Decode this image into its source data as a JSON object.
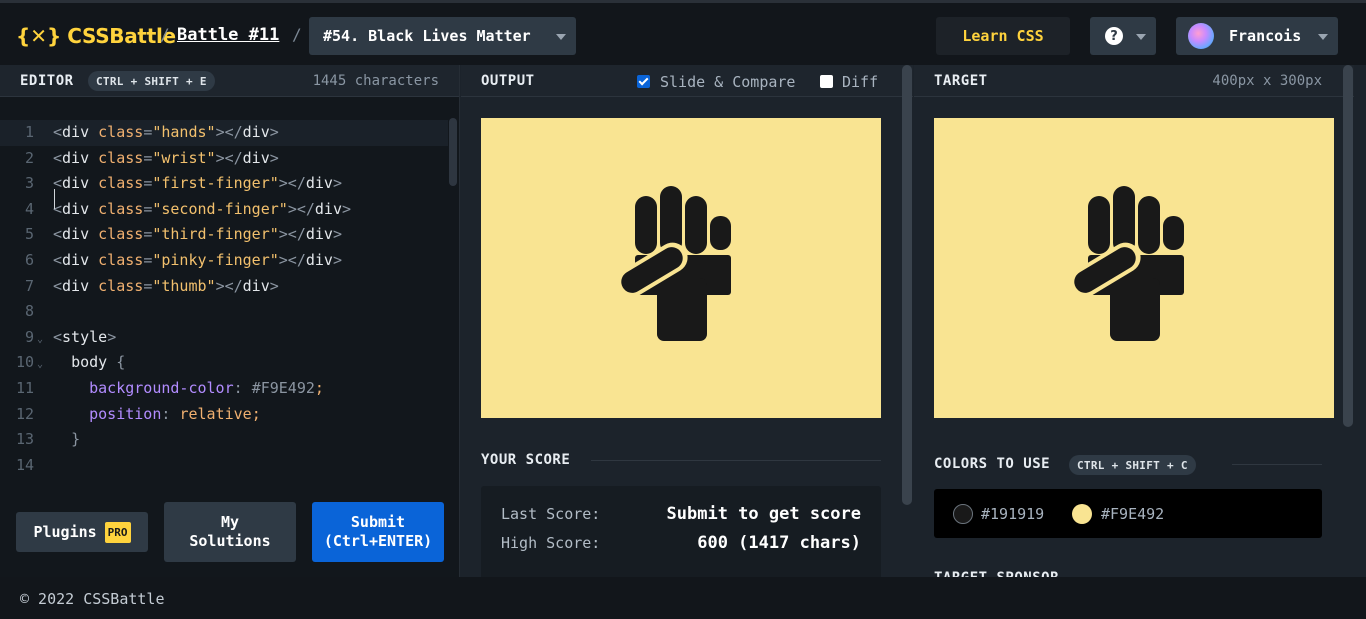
{
  "header": {
    "logo_mark": "{✕}",
    "logo_text": "CSSBattle",
    "separator": "/",
    "battle_link": "Battle #11",
    "target_name": "#54. Black Lives Matter",
    "learn_css": "Learn CSS",
    "help_glyph": "?",
    "user_name": "Francois"
  },
  "editor": {
    "title": "EDITOR",
    "shortcut": "CTRL + SHIFT + E",
    "char_count": "1445 characters",
    "lines": [
      {
        "n": "1",
        "html": "<div class=\"hands\"></div>"
      },
      {
        "n": "2",
        "html": "<div class=\"wrist\"></div>"
      },
      {
        "n": "3",
        "html": "<div class=\"first-finger\"></div>"
      },
      {
        "n": "4",
        "html": "<div class=\"second-finger\"></div>"
      },
      {
        "n": "5",
        "html": "<div class=\"third-finger\"></div>"
      },
      {
        "n": "6",
        "html": "<div class=\"pinky-finger\"></div>"
      },
      {
        "n": "7",
        "html": "<div class=\"thumb\"></div>"
      },
      {
        "n": "8",
        "html": ""
      },
      {
        "n": "9",
        "html": "<style>"
      },
      {
        "n": "10",
        "html": "  body {"
      },
      {
        "n": "11",
        "html": "    background-color: #F9E492;"
      },
      {
        "n": "12",
        "html": "    position: relative;"
      },
      {
        "n": "13",
        "html": "  }"
      },
      {
        "n": "14",
        "html": ""
      }
    ],
    "plugins_label": "Plugins",
    "pro_label": "PRO",
    "solutions_line1": "My",
    "solutions_line2": "Solutions",
    "submit_line1": "Submit",
    "submit_line2": "(Ctrl+ENTER)"
  },
  "output": {
    "title": "OUTPUT",
    "slide_compare": "Slide & Compare",
    "slide_checked": true,
    "diff": "Diff",
    "diff_checked": false,
    "score_title": "YOUR SCORE",
    "last_score_label": "Last Score:",
    "last_score_value": "Submit to get score",
    "high_score_label": "High Score:",
    "high_score_value": "600 (1417 chars)"
  },
  "target": {
    "title": "TARGET",
    "size": "400px x 300px",
    "colors_title": "COLORS TO USE",
    "colors_shortcut": "CTRL + SHIFT + C",
    "colors": [
      {
        "hex": "#191919",
        "label": "#191919"
      },
      {
        "hex": "#F9E492",
        "label": "#F9E492"
      }
    ],
    "sponsor_title": "TARGET SPONSOR"
  },
  "canvas": {
    "background": "#F9E492",
    "foreground": "#191919"
  },
  "footer": {
    "copyright": "© 2022 CSSBattle"
  }
}
